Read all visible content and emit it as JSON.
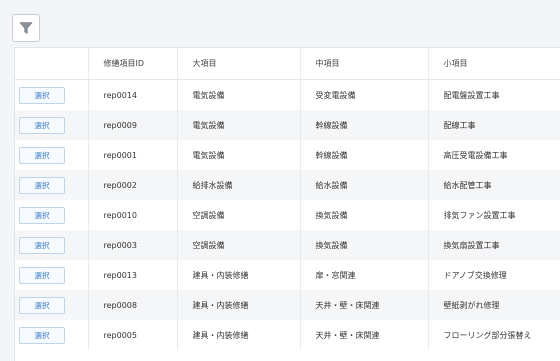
{
  "toolbar": {
    "filter_icon": "filter-icon"
  },
  "table": {
    "headers": [
      "",
      "修繕項目ID",
      "大項目",
      "中項目",
      "小項目"
    ],
    "select_label": "選択",
    "rows": [
      {
        "id": "rep0014",
        "major": "電気設備",
        "middle": "受変電設備",
        "minor": "配電盤設置工事"
      },
      {
        "id": "rep0009",
        "major": "電気設備",
        "middle": "幹線設備",
        "minor": "配線工事"
      },
      {
        "id": "rep0001",
        "major": "電気設備",
        "middle": "幹線設備",
        "minor": "高圧受電設備工事"
      },
      {
        "id": "rep0002",
        "major": "給排水設備",
        "middle": "給水設備",
        "minor": "給水配管工事"
      },
      {
        "id": "rep0010",
        "major": "空調設備",
        "middle": "換気設備",
        "minor": "排気ファン設置工事"
      },
      {
        "id": "rep0003",
        "major": "空調設備",
        "middle": "換気設備",
        "minor": "換気扇設置工事"
      },
      {
        "id": "rep0013",
        "major": "建具・内装修繕",
        "middle": "扉・窓関連",
        "minor": "ドアノブ交換修理"
      },
      {
        "id": "rep0008",
        "major": "建具・内装修繕",
        "middle": "天井・壁・床関連",
        "minor": "壁紙剥がれ修理"
      },
      {
        "id": "rep0005",
        "major": "建具・内装修繕",
        "middle": "天井・壁・床関連",
        "minor": "フローリング部分張替え"
      }
    ]
  }
}
